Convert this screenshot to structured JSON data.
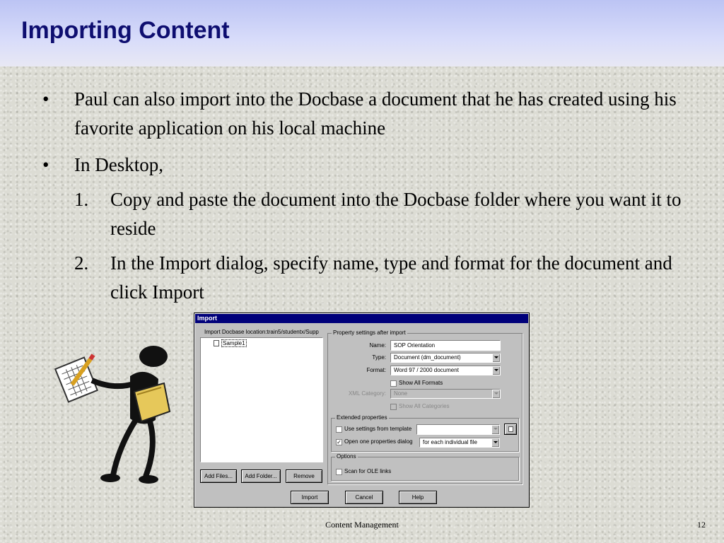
{
  "slide": {
    "title": "Importing Content",
    "bullet_char": "•",
    "bullets": [
      "Paul can also import into the Docbase a document that he has created using his favorite application on his local machine",
      "In Desktop,"
    ],
    "steps": [
      {
        "num": "1.",
        "text": "Copy and paste the document into the Docbase folder where you want it to reside"
      },
      {
        "num": "2.",
        "text": "In the Import dialog, specify name, type and format for the document and click Import"
      }
    ],
    "footer_center": "Content Management",
    "page_number": "12"
  },
  "dialog": {
    "title": "Import",
    "location_label": "Import Docbase location:train5/studentx/Supp",
    "tree_item": "Sample1",
    "buttons": {
      "add_files": "Add Files...",
      "add_folder": "Add Folder...",
      "remove": "Remove",
      "import": "Import",
      "cancel": "Cancel",
      "help": "Help"
    },
    "property_group": "Property settings after import",
    "name_label": "Name:",
    "name_value": "SOP Orientation",
    "type_label": "Type:",
    "type_value": "Document (dm_document)",
    "format_label": "Format:",
    "format_value": "Word 97 / 2000 document",
    "show_all_formats": "Show All Formats",
    "xml_label": "XML Category:",
    "xml_value": "None",
    "show_all_categories": "Show All Categories",
    "extended_group": "Extended properties",
    "use_settings": "Use settings from template",
    "open_props": "Open one properties dialog",
    "open_props_value": "for each individual file",
    "options_group": "Options",
    "scan_ole": "Scan for OLE links"
  }
}
